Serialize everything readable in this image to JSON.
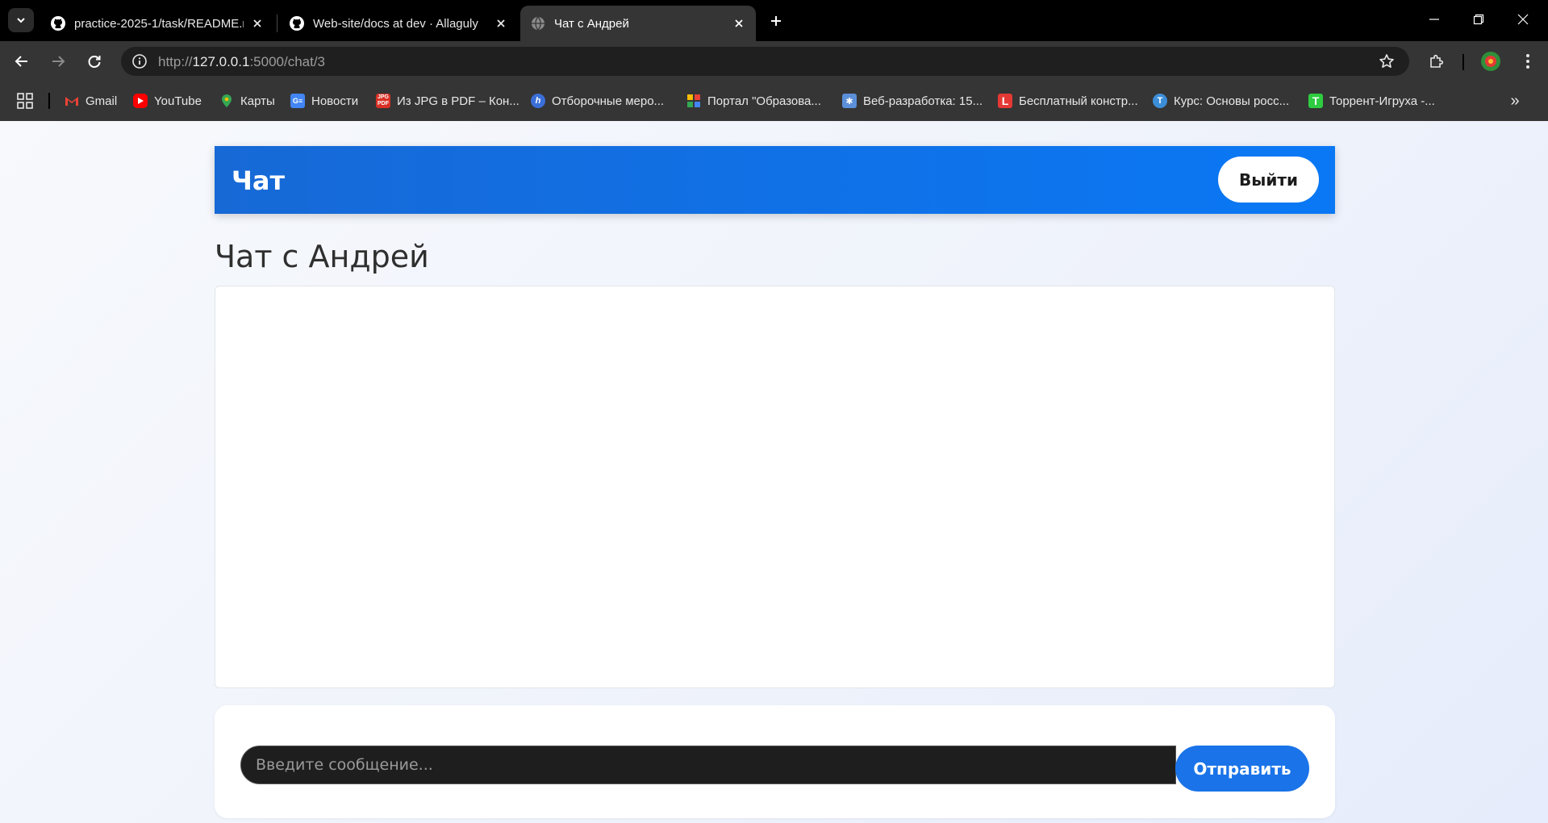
{
  "browser": {
    "tabs": [
      {
        "title": "practice-2025-1/task/README.md",
        "icon": "github-icon",
        "active": false
      },
      {
        "title": "Web-site/docs at dev · Allaguly",
        "icon": "github-icon",
        "active": false
      },
      {
        "title": "Чат с Андрей",
        "icon": "globe-icon",
        "active": true
      }
    ],
    "address": {
      "scheme": "http://",
      "host": "127.0.0.1",
      "rest": ":5000/chat/3"
    },
    "bookmarks": [
      {
        "label": "Gmail",
        "icon": "gmail-icon",
        "color": "#ea4335"
      },
      {
        "label": "YouTube",
        "icon": "youtube-icon",
        "color": "#ff0000"
      },
      {
        "label": "Карты",
        "icon": "maps-icon",
        "color": "#34a853"
      },
      {
        "label": "Новости",
        "icon": "news-icon",
        "color": "#4285f4"
      },
      {
        "label": "Из JPG в PDF – Кон...",
        "icon": "jpg-pdf-icon",
        "color": "#d93025"
      },
      {
        "label": "Отборочные меро...",
        "icon": "hh-icon",
        "color": "#3b6fd8"
      },
      {
        "label": "Портал \"Образова...",
        "icon": "portal-icon",
        "color": "#fbbc04"
      },
      {
        "label": "Веб-разработка: 15...",
        "icon": "web-dev-icon",
        "color": "#5b8fd9"
      },
      {
        "label": "Бесплатный констр...",
        "icon": "l-icon",
        "color": "#e53935"
      },
      {
        "label": "Курс: Основы росс...",
        "icon": "course-icon",
        "color": "#3c8ed8"
      },
      {
        "label": "Торрент-Игруха -...",
        "icon": "torrent-icon",
        "color": "#2ecc40"
      }
    ]
  },
  "app": {
    "header_title": "Чат",
    "logout_label": "Выйти",
    "chat_heading": "Чат с Андрей",
    "messages": [],
    "input_placeholder": "Введите сообщение...",
    "send_label": "Отправить",
    "accent_color": "#1a73e8"
  }
}
